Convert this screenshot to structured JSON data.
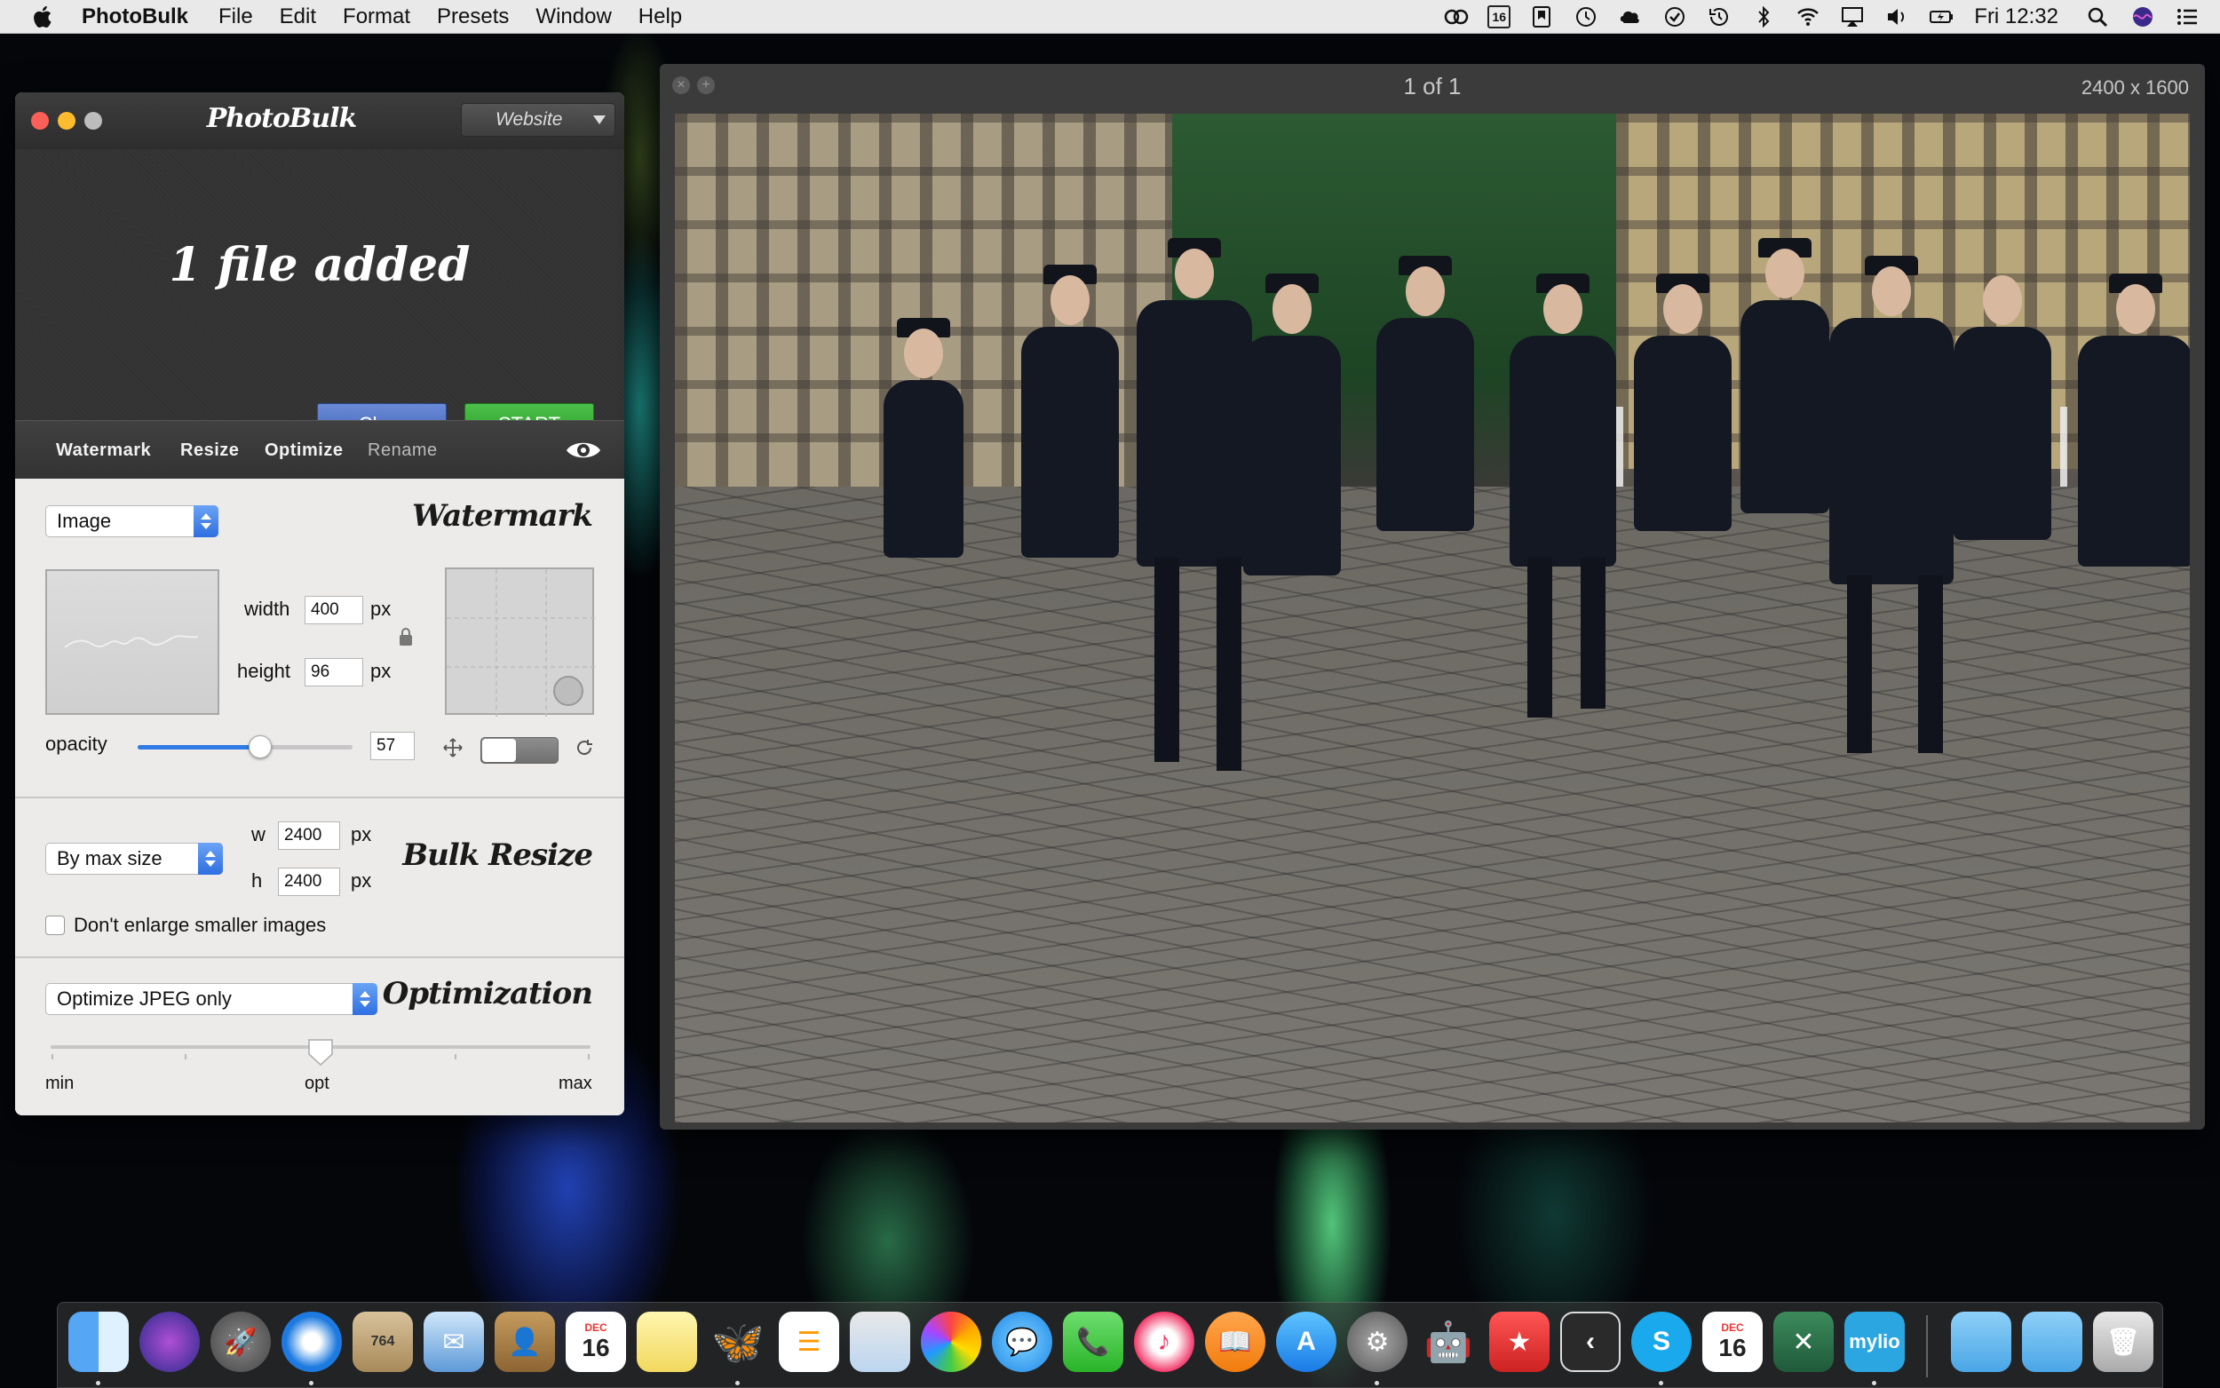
{
  "menubar": {
    "app_name": "PhotoBulk",
    "menus": [
      "File",
      "Edit",
      "Format",
      "Presets",
      "Window",
      "Help"
    ],
    "calendar_badge": "16",
    "clock": "Fri 12:32"
  },
  "photobulk": {
    "logo": "PhotoBulk",
    "preset": "Website",
    "status": "1 file added",
    "clear_label": "Clear",
    "start_label": "START",
    "tabs": [
      "Watermark",
      "Resize",
      "Optimize",
      "Rename"
    ],
    "watermark": {
      "title": "Watermark",
      "type": "Image",
      "width_label": "width",
      "width_value": "400",
      "height_label": "height",
      "height_value": "96",
      "unit": "px",
      "opacity_label": "opacity",
      "opacity_value": "57",
      "opacity_fraction": 0.57
    },
    "resize": {
      "title": "Bulk Resize",
      "mode": "By max size",
      "w_label": "w",
      "w_value": "2400",
      "h_label": "h",
      "h_value": "2400",
      "unit": "px",
      "dont_enlarge_label": "Don't enlarge smaller images",
      "dont_enlarge_checked": false
    },
    "optimization": {
      "title": "Optimization",
      "mode": "Optimize JPEG only",
      "min_label": "min",
      "opt_label": "opt",
      "max_label": "max",
      "level_fraction": 0.5
    }
  },
  "preview": {
    "title": "1 of 1",
    "dimensions": "2400 x 1600"
  },
  "dock": {
    "calendar_month": "DEC",
    "calendar_day": "16",
    "package_badge": "764",
    "mylio_label": "mylio",
    "apps": [
      "finder-icon",
      "siri-icon",
      "launchpad-icon",
      "safari-icon",
      "package-icon",
      "mail-icon",
      "contacts-icon",
      "calendar-icon",
      "notes-icon",
      "tes-icon",
      "reminders-icon",
      "preview-icon",
      "photos-icon",
      "messages-icon",
      "facetime-icon",
      "itunes-icon",
      "ibooks-icon",
      "app-store-icon",
      "system-preferences-icon",
      "automator-icon",
      "bookmark-icon",
      "back-icon",
      "skype-icon",
      "calendar2-icon",
      "xcode-icon",
      "mylio-icon",
      "folder-icon",
      "folder2-icon",
      "trash-icon"
    ]
  }
}
